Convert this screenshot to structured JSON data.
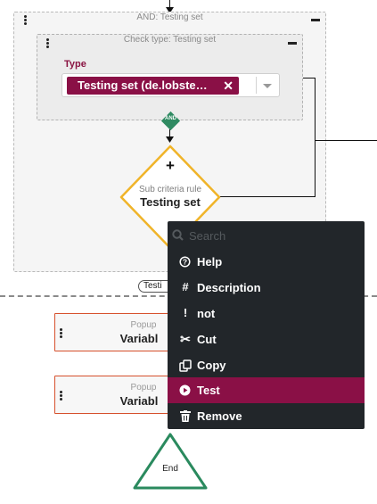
{
  "and_group": {
    "title": "AND: Testing set"
  },
  "check_group": {
    "title": "Check type: Testing set",
    "type_label": "Type",
    "selected_chip": "Testing set (de.lobste…"
  },
  "and_badge": "AND",
  "sub_rule": {
    "plus": "+",
    "caption": "Sub criteria rule",
    "name": "Testing set"
  },
  "flow_pill": "Testi",
  "popups": [
    {
      "caption": "Popup",
      "name": "Variabl"
    },
    {
      "caption": "Popup",
      "name": "Variabl"
    }
  ],
  "end_label": "End",
  "context_menu": {
    "search_placeholder": "Search",
    "items": [
      {
        "label": "Help",
        "icon": "help-circle-icon",
        "glyph": "?"
      },
      {
        "label": "Description",
        "icon": "hash-icon",
        "glyph": "#"
      },
      {
        "label": "not",
        "icon": "exclamation-icon",
        "glyph": "!"
      },
      {
        "label": "Cut",
        "icon": "scissors-icon",
        "glyph": "✂"
      },
      {
        "label": "Copy",
        "icon": "copy-icon",
        "glyph": "⧉"
      },
      {
        "label": "Test",
        "icon": "play-circle-icon",
        "glyph": "▶",
        "active": true
      },
      {
        "label": "Remove",
        "icon": "trash-icon",
        "glyph": "🗑"
      }
    ]
  },
  "colors": {
    "accent": "#8a1046",
    "menu_bg": "#22262a",
    "and_green": "#2f8a62",
    "rule_orange": "#f0b429",
    "end_green": "#2a8a5e",
    "popup_border": "#d6502c"
  }
}
